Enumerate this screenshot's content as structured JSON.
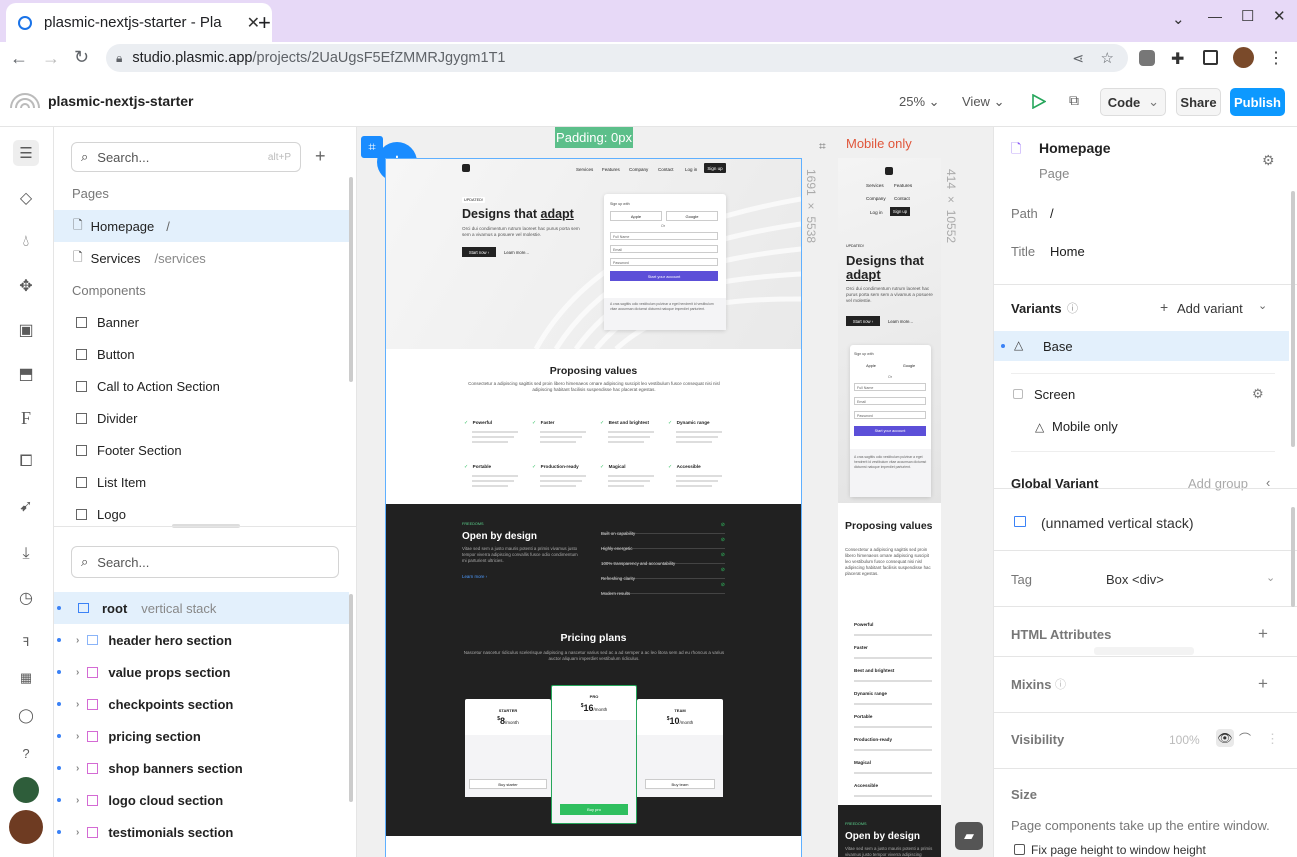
{
  "browser": {
    "tab_title": "plasmic-nextjs-starter - Pla",
    "new_tab": "+",
    "window_controls": [
      "⌄",
      "—",
      "☐",
      "✕"
    ],
    "url_domain": "studio.plasmic.app",
    "url_path": "/projects/2UaUgsF5EfZMMRJgygm1T1"
  },
  "app": {
    "project_name": "plasmic-nextjs-starter",
    "zoom": "25%",
    "view": "View",
    "code": "Code",
    "share": "Share",
    "publish": "Publish",
    "accent": "#0d99ff"
  },
  "left": {
    "search_placeholder": "Search...",
    "search_shortcut": "alt+P",
    "add": "+",
    "pages_label": "Pages",
    "pages": [
      {
        "name": "Homepage",
        "path": "/"
      },
      {
        "name": "Services",
        "path": "/services"
      }
    ],
    "components_label": "Components",
    "components": [
      "Banner",
      "Button",
      "Call to Action Section",
      "Divider",
      "Footer Section",
      "List Item",
      "Logo"
    ],
    "tree_search_placeholder": "Search...",
    "tree": {
      "root": "root",
      "root_type": "vertical stack",
      "items": [
        "header hero section",
        "value props section",
        "checkpoints section",
        "pricing section",
        "shop banners section",
        "logo cloud section",
        "testimonials section"
      ]
    }
  },
  "canvas": {
    "padding_badge": "Padding: 0px",
    "mobile_label": "Mobile only",
    "desktop_dims": "1691 × 5538",
    "mobile_dims": "414 × 10552",
    "site": {
      "nav": [
        "Services",
        "Features",
        "Company",
        "Contact",
        "Log in"
      ],
      "signup": "Sign up",
      "badge": "UPDATED!",
      "hero_title_a": "Designs that ",
      "hero_title_b": "adapt",
      "hero_body": "Orci dui condimentum rutrum laoreet hac purus porta sem sem a vivamus a posuere vel molestie.",
      "start_now": "Start now ›",
      "learn_more": "Learn more...",
      "signup_with": "Sign up with",
      "apple": "Apple",
      "google": "Google",
      "or": "Or",
      "full_name": "Full Name",
      "email": "Email",
      "password": "Password",
      "start_account": "Start your account",
      "form_note": "A cras sagittis odio vestibulum pulvinar a eget hendrerit id vestibulum vitae accumsan dictumst dictumst natoque imperdiet parturient.",
      "props_title": "Proposing values",
      "props_body": "Consectetur a adipiscing sagittis sed proin libero himenaeos ornare adipiscing suscipit leo vestibulum fusce consequat nisi nisl adipiscing habitant facilisis suspendisse hac placerat egestas.",
      "props": [
        "Powerful",
        "Faster",
        "Best and brightest",
        "Dynamic range",
        "Portable",
        "Production-ready",
        "Magical",
        "Accessible"
      ],
      "dark_badge": "FREEDOMS",
      "dark_title": "Open by design",
      "dark_body": "Vitae sed sem a justo mauris potenti a primis vivamus justo tempor viverra adipiscing convallis fusce odio condimentum mi parturient ultricies.",
      "dark_link": "Learn more ›",
      "checks": [
        "Built on capability",
        "Highly energetic",
        "100% transparency and accountability",
        "Refreshing clarity",
        "Modern results"
      ],
      "pricing_title": "Pricing plans",
      "pricing_body": "Nascetur nascetur ridiculus scelerisque adipiscing a nascetur varius sed ac a ad semper a ac leo litora sem ad eu rhoncus a varius auctor aliquam imperdiet vestibulum ridiculus.",
      "plans": [
        {
          "name": "STARTER",
          "price": "8",
          "per": "/month",
          "cta": "Buy starter"
        },
        {
          "name": "PRO",
          "price": "16",
          "per": "/month",
          "cta": "Buy pro"
        },
        {
          "name": "TEAM",
          "price": "10",
          "per": "/month",
          "cta": "Buy team"
        }
      ]
    }
  },
  "right": {
    "page_title": "Homepage",
    "page_type": "Page",
    "path_label": "Path",
    "path_value": "/",
    "title_label": "Title",
    "title_value": "Home",
    "variants_label": "Variants",
    "add_variant": "Add variant",
    "base": "Base",
    "screen": "Screen",
    "mobile_only": "Mobile only",
    "global_variant": "Global Variant",
    "add_group": "Add group",
    "element": "(unnamed vertical stack)",
    "tag_label": "Tag",
    "tag_value": "Box <div>",
    "html_attrs": "HTML Attributes",
    "mixins": "Mixins",
    "visibility": "Visibility",
    "visibility_value": "100%",
    "size": "Size",
    "size_note": "Page components take up the entire window.",
    "fix_height": "Fix page height to window height"
  }
}
